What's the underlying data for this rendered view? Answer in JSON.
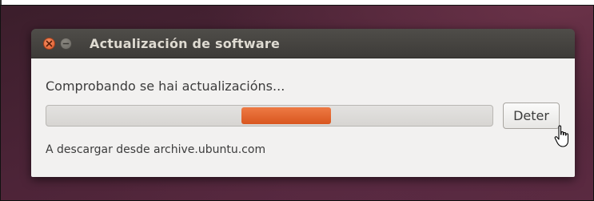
{
  "window": {
    "title": "Actualización de software",
    "controls": [
      "close-icon",
      "minimize-icon"
    ]
  },
  "dialog": {
    "status": "Comprobando se hai actualizacións...",
    "progress_mode": "indeterminate",
    "stop_label": "Deter",
    "download_status": "A descargar desde archive.ubuntu.com"
  },
  "colors": {
    "accent": "#e35d26",
    "titlebar": "#45433f",
    "content_bg": "#f2f1f0",
    "desktop": "#4d2438"
  },
  "pointer": "hand-cursor-icon"
}
